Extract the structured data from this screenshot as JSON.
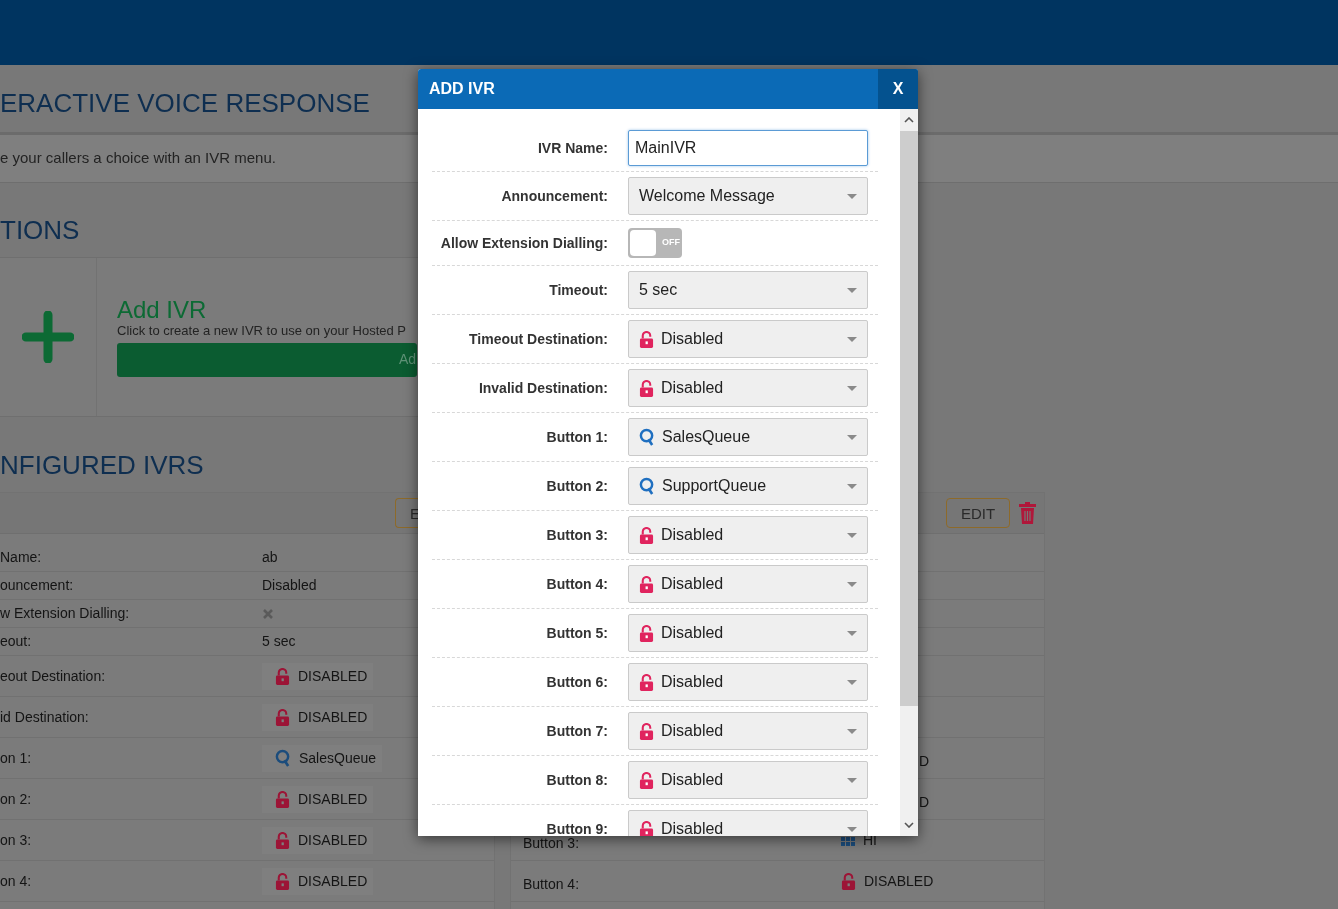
{
  "page": {
    "title": "ERACTIVE VOICE RESPONSE",
    "intro": "e your callers a choice with an IVR menu.",
    "actions_heading": "TIONS",
    "add_card": {
      "title": "Add IVR",
      "description": "Click to create a new IVR to use on your Hosted P",
      "button": "Ad"
    },
    "configured_heading": "NFIGURED IVRS"
  },
  "ivr_cards": [
    {
      "edit_label": "E",
      "rows": [
        {
          "kind": "text",
          "label": "Name:",
          "value": "ab"
        },
        {
          "kind": "text",
          "label": "ouncement:",
          "value": "Disabled"
        },
        {
          "kind": "flag",
          "label": "w Extension Dialling:",
          "on": false
        },
        {
          "kind": "text",
          "label": "eout:",
          "value": "5 sec"
        },
        {
          "kind": "dest",
          "label": "eout Destination:",
          "icon": {
            "kind": "lock"
          },
          "value": "DISABLED"
        },
        {
          "kind": "dest",
          "label": "id Destination:",
          "icon": {
            "kind": "lock"
          },
          "value": "DISABLED"
        },
        {
          "kind": "dest",
          "label": "on 1:",
          "icon": {
            "kind": "queue"
          },
          "value": "SalesQueue"
        },
        {
          "kind": "dest",
          "label": "on 2:",
          "icon": {
            "kind": "lock"
          },
          "value": "DISABLED"
        },
        {
          "kind": "dest",
          "label": "on 3:",
          "icon": {
            "kind": "lock"
          },
          "value": "DISABLED"
        },
        {
          "kind": "dest",
          "label": "on 4:",
          "icon": {
            "kind": "lock"
          },
          "value": "DISABLED"
        }
      ]
    },
    {
      "edit_label": "EDIT",
      "delete": true,
      "rows": [
        {
          "kind": "covered"
        },
        {
          "kind": "covered"
        },
        {
          "kind": "covered"
        },
        {
          "kind": "covered"
        },
        {
          "kind": "covered"
        },
        {
          "kind": "covered"
        },
        {
          "kind": "covered",
          "value": "D"
        },
        {
          "kind": "covered",
          "value": "D"
        },
        {
          "kind": "dest",
          "label": "Button 3:",
          "icon": {
            "kind": "grid"
          },
          "value": "HI"
        },
        {
          "kind": "dest",
          "label": "Button 4:",
          "icon": {
            "kind": "lock"
          },
          "value": "DISABLED"
        }
      ]
    }
  ],
  "modal": {
    "title": "ADD IVR",
    "close": "X",
    "fields": [
      {
        "kind": "input",
        "label": "IVR Name:",
        "value": "MainIVR"
      },
      {
        "kind": "select",
        "label": "Announcement:",
        "value": "Welcome Message"
      },
      {
        "kind": "toggle",
        "label": "Allow Extension Dialling:",
        "on": false,
        "state_text": "OFF"
      },
      {
        "kind": "select",
        "label": "Timeout:",
        "value": "5 sec"
      },
      {
        "kind": "select",
        "label": "Timeout Destination:",
        "icon": {
          "kind": "lock"
        },
        "value": "Disabled"
      },
      {
        "kind": "select",
        "label": "Invalid Destination:",
        "icon": {
          "kind": "lock"
        },
        "value": "Disabled"
      },
      {
        "kind": "select",
        "label": "Button 1:",
        "icon": {
          "kind": "queue"
        },
        "value": "SalesQueue"
      },
      {
        "kind": "select",
        "label": "Button 2:",
        "icon": {
          "kind": "queue"
        },
        "value": "SupportQueue"
      },
      {
        "kind": "select",
        "label": "Button 3:",
        "icon": {
          "kind": "lock"
        },
        "value": "Disabled"
      },
      {
        "kind": "select",
        "label": "Button 4:",
        "icon": {
          "kind": "lock"
        },
        "value": "Disabled"
      },
      {
        "kind": "select",
        "label": "Button 5:",
        "icon": {
          "kind": "lock"
        },
        "value": "Disabled"
      },
      {
        "kind": "select",
        "label": "Button 6:",
        "icon": {
          "kind": "lock"
        },
        "value": "Disabled"
      },
      {
        "kind": "select",
        "label": "Button 7:",
        "icon": {
          "kind": "lock"
        },
        "value": "Disabled"
      },
      {
        "kind": "select",
        "label": "Button 8:",
        "icon": {
          "kind": "lock"
        },
        "value": "Disabled"
      },
      {
        "kind": "select",
        "label": "Button 9:",
        "icon": {
          "kind": "lock"
        },
        "value": "Disabled"
      }
    ]
  }
}
